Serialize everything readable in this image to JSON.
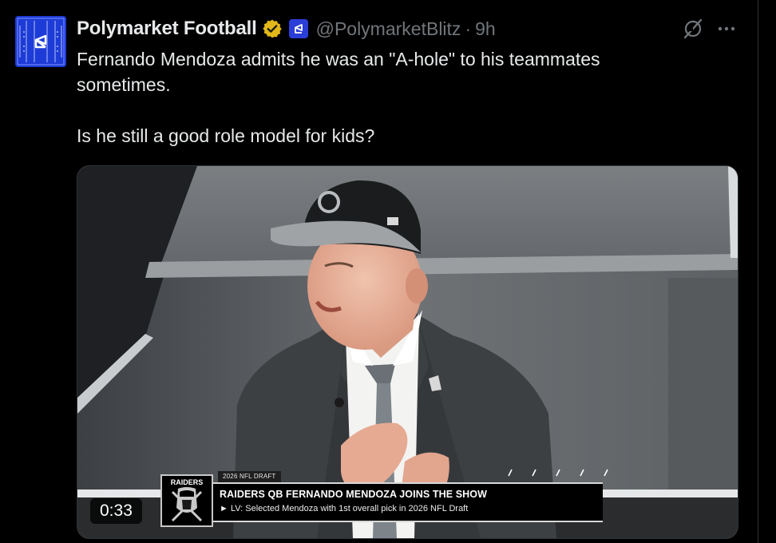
{
  "post": {
    "display_name": "Polymarket Football",
    "handle": "@PolymarketBlitz",
    "separator": "·",
    "timestamp": "9h",
    "text_line_1": "Fernando Mendoza admits he was an \"A-hole\" to his teammates sometimes.",
    "text_line_2": "Is he still a good role model for kids?",
    "icons": {
      "avatar": "football-field-logo",
      "verified": "gold-verified-badge-icon",
      "affiliate": "polymarket-affiliate-icon",
      "grok": "grok-icon",
      "more": "more-options-icon"
    }
  },
  "video": {
    "duration": "0:33",
    "lower_third": {
      "kicker": "2026 NFL DRAFT",
      "badge_text": "RAIDERS",
      "headline": "RAIDERS QB FERNANDO MENDOZA JOINS THE SHOW",
      "subline": "► LV: Selected Mendoza with 1st overall pick in 2026 NFL Draft"
    }
  },
  "colors": {
    "background": "#000000",
    "text_primary": "#e7e9ea",
    "text_secondary": "#71767b",
    "verified_gold": "#e2b719",
    "avatar_blue": "#1d3bd6"
  }
}
